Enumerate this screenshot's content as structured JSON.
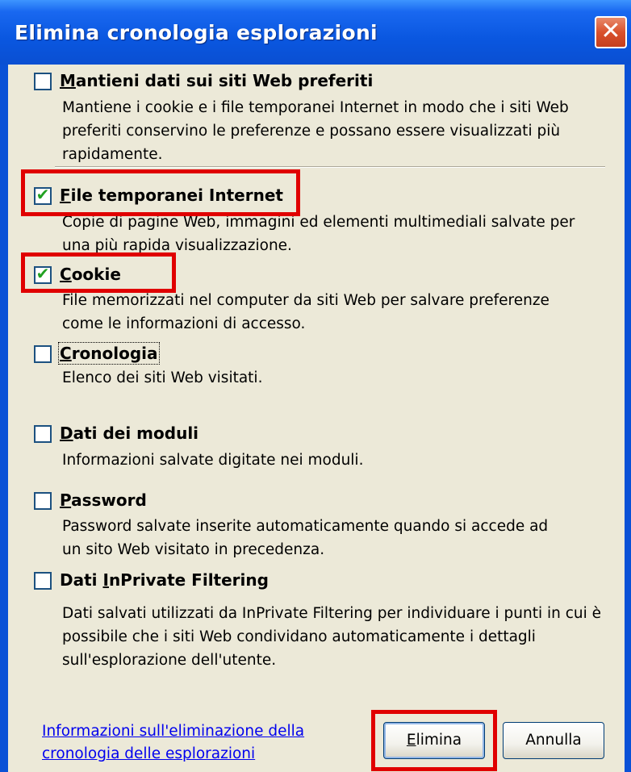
{
  "window": {
    "title": "Elimina cronologia esplorazioni",
    "close_glyph": "✕"
  },
  "options": [
    {
      "label_mnemonic": "M",
      "label_rest": "antieni dati sui siti Web preferiti",
      "checked": false,
      "description": [
        "Mantiene i cookie e i file temporanei Internet in modo che i siti Web",
        "preferiti conservino le preferenze e possano essere visualizzati più",
        "rapidamente."
      ]
    },
    {
      "label_mnemonic": "F",
      "label_rest": "ile temporanei Internet",
      "checked": true,
      "description": [
        "Copie di pagine Web, immagini ed elementi multimediali salvate per",
        "una più rapida visualizzazione."
      ]
    },
    {
      "label_mnemonic": "C",
      "label_rest": "ookie",
      "checked": true,
      "description": [
        "File memorizzati nel computer da siti Web per salvare preferenze",
        "come le informazioni di accesso."
      ]
    },
    {
      "label_mnemonic": "C",
      "label_rest": "ronologia",
      "checked": false,
      "description": [
        "Elenco dei siti Web visitati."
      ]
    },
    {
      "label_mnemonic": "D",
      "label_rest": "ati dei moduli",
      "checked": false,
      "description": [
        "Informazioni salvate digitate nei moduli."
      ]
    },
    {
      "label_mnemonic": "P",
      "label_rest": "assword",
      "checked": false,
      "description": [
        "Password salvate inserite automaticamente quando si accede ad",
        "un sito Web visitato in precedenza."
      ]
    },
    {
      "label_prefix": "Dati ",
      "label_mnemonic": "I",
      "label_rest": "nPrivate Filtering",
      "checked": false,
      "description": [
        "Dati salvati utilizzati da InPrivate Filtering per individuare i punti in cui è",
        "possibile che i siti Web condividano automaticamente i dettagli",
        "sull'esplorazione dell'utente."
      ]
    }
  ],
  "check_glyph": "✔",
  "footer": {
    "link_lines": [
      "Informazioni sull'eliminazione della",
      "cronologia delle esplorazioni"
    ],
    "delete_mnemonic": "E",
    "delete_rest": "limina",
    "cancel_label": "Annulla"
  },
  "colors": {
    "title_bar": "#0a57e0",
    "dialog_face": "#ece9d8",
    "highlight": "#e00000",
    "checkmark": "#21a121",
    "link": "#0000ee"
  }
}
